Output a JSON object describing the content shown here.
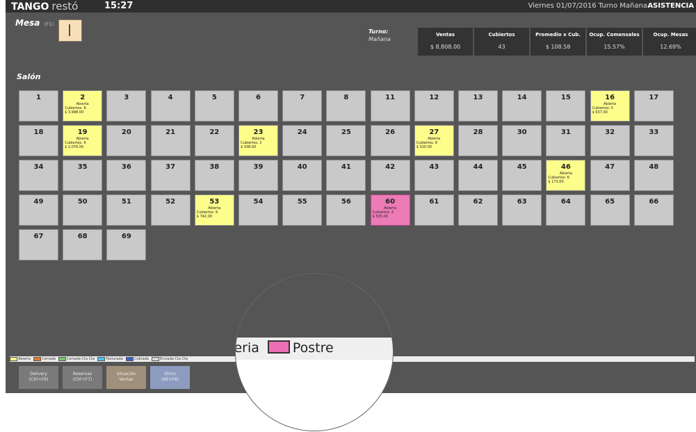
{
  "header": {
    "brand_bold": "TANGO",
    "brand_light": "restó",
    "time": "15:27",
    "date_turno": "Viernes 01/07/2016 Turno Mañana",
    "mode": "ASISTENCIA"
  },
  "mesa": {
    "label": "Mesa",
    "shortcut": "(F1)",
    "value": ""
  },
  "turno": {
    "label": "Turno:",
    "value": "Mañana"
  },
  "stats": [
    {
      "label": "Ventas",
      "value": "$ 8,808.00"
    },
    {
      "label": "Cubiertos",
      "value": "43"
    },
    {
      "label": "Promedio x Cub.",
      "value": "$ 108.58"
    },
    {
      "label": "Ocup. Comensales",
      "value": "15.57%"
    },
    {
      "label": "Ocup. Mesas",
      "value": "12.69%"
    }
  ],
  "salon": {
    "title": "Salón"
  },
  "tables": [
    {
      "n": "1"
    },
    {
      "n": "2",
      "status": "Abierta",
      "cub": "Cubiertos: 8",
      "amt": "$ 3,998.00",
      "color": "yellow"
    },
    {
      "n": "3"
    },
    {
      "n": "4"
    },
    {
      "n": "5"
    },
    {
      "n": "6"
    },
    {
      "n": "7"
    },
    {
      "n": "8"
    },
    {
      "n": "11"
    },
    {
      "n": "12"
    },
    {
      "n": "13"
    },
    {
      "n": "14"
    },
    {
      "n": "15"
    },
    {
      "n": "16",
      "status": "Abierta",
      "cub": "Cubiertos: 5",
      "amt": "$ 637.00",
      "color": "yellow"
    },
    {
      "n": "17"
    },
    {
      "n": "18"
    },
    {
      "n": "19",
      "status": "Abierta",
      "cub": "Cubiertos: 6",
      "amt": "$ 1,076.00",
      "color": "yellow"
    },
    {
      "n": "20"
    },
    {
      "n": "21"
    },
    {
      "n": "22"
    },
    {
      "n": "23",
      "status": "Abierta",
      "cub": "Cubiertos: 2",
      "amt": "$ 938.00",
      "color": "yellow"
    },
    {
      "n": "24"
    },
    {
      "n": "25"
    },
    {
      "n": "26"
    },
    {
      "n": "27",
      "status": "Abierta",
      "cub": "Cubiertos: 8",
      "amt": "$ 520.00",
      "color": "yellow"
    },
    {
      "n": "28"
    },
    {
      "n": "30"
    },
    {
      "n": "31"
    },
    {
      "n": "32"
    },
    {
      "n": "33"
    },
    {
      "n": "34"
    },
    {
      "n": "35"
    },
    {
      "n": "36"
    },
    {
      "n": "37"
    },
    {
      "n": "38"
    },
    {
      "n": "39"
    },
    {
      "n": "40"
    },
    {
      "n": "41"
    },
    {
      "n": "42"
    },
    {
      "n": "43"
    },
    {
      "n": "44"
    },
    {
      "n": "45"
    },
    {
      "n": "46",
      "status": "Abierta",
      "cub": "Cubiertos: 6",
      "amt": "$ 173.00",
      "color": "yellow"
    },
    {
      "n": "47"
    },
    {
      "n": "48"
    },
    {
      "n": "49"
    },
    {
      "n": "50"
    },
    {
      "n": "51"
    },
    {
      "n": "52"
    },
    {
      "n": "53",
      "status": "Abierta",
      "cub": "Cubiertos: 9",
      "amt": "$ 742.00",
      "color": "yellow"
    },
    {
      "n": "54"
    },
    {
      "n": "55"
    },
    {
      "n": "56"
    },
    {
      "n": "60",
      "status": "Abierta",
      "cub": "Cubiertos: 2",
      "amt": "$ 535.00",
      "color": "pink"
    },
    {
      "n": "61"
    },
    {
      "n": "62"
    },
    {
      "n": "63"
    },
    {
      "n": "64"
    },
    {
      "n": "65"
    },
    {
      "n": "66"
    },
    {
      "n": "67"
    },
    {
      "n": "68"
    },
    {
      "n": "69"
    }
  ],
  "legend": [
    {
      "label": "Abierta",
      "color": "#fdfd8c"
    },
    {
      "label": "Cerrada",
      "color": "#e07b2e"
    },
    {
      "label": "Cerrada Cta Cte",
      "color": "#7cc66a"
    },
    {
      "label": "Facturada",
      "color": "#4fc3e6"
    },
    {
      "label": "Cobrada",
      "color": "#3b5fc4"
    },
    {
      "label": "Enviada Cta Cte",
      "color": "#d8d8d8"
    }
  ],
  "magnifier": {
    "text_left": "teria",
    "text_right": "Postre",
    "swatch_color": "#ec6fb5"
  },
  "buttons": [
    {
      "line1": "Delivery",
      "line2": "(Ctrl+F6)",
      "style": "d"
    },
    {
      "line1": "Reservas",
      "line2": "(Ctrl+F7)",
      "style": "d"
    },
    {
      "line1": "Situación",
      "line2": "Ventas",
      "style": "s"
    },
    {
      "line1": "Otros",
      "line2": "(Alt+F8)",
      "style": "o"
    }
  ]
}
